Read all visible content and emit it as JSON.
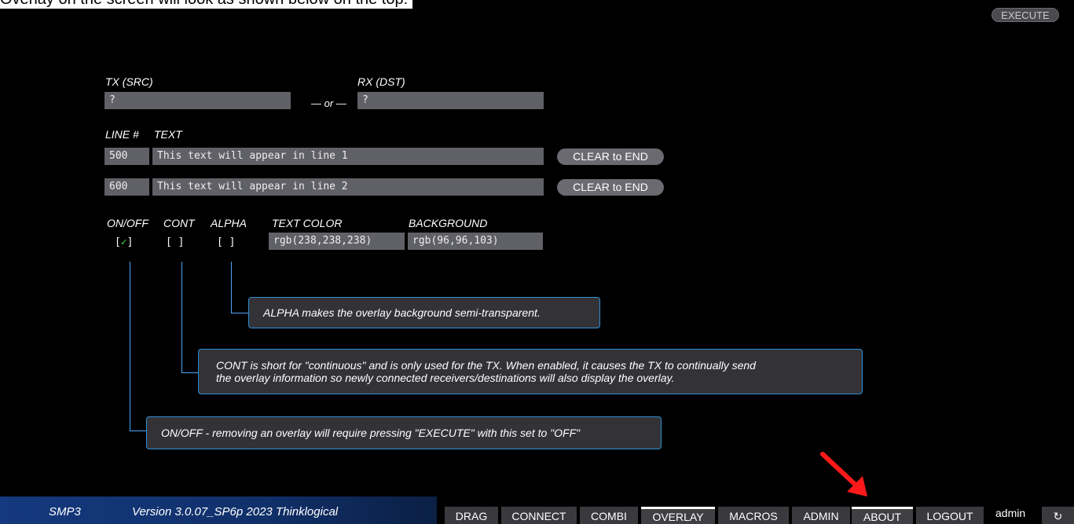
{
  "top_strip": {
    "text": "Overlay on the screen will look as shown below on the top:"
  },
  "execute_label": "EXECUTE",
  "source": {
    "tx_label": "TX (SRC)",
    "rx_label": "RX (DST)",
    "or_label": "— or —",
    "tx_value": "?",
    "rx_value": "?"
  },
  "lines_header": {
    "line_num_label": "LINE #",
    "text_label": "TEXT"
  },
  "lines": [
    {
      "number": "500",
      "text": "This text will appear in line 1",
      "clear_label": "CLEAR to END"
    },
    {
      "number": "600",
      "text": "This text will appear in line 2",
      "clear_label": "CLEAR to END"
    }
  ],
  "options": {
    "onoff_label": "ON/OFF",
    "cont_label": "CONT",
    "alpha_label": "ALPHA",
    "text_color_label": "TEXT COLOR",
    "background_label": "BACKGROUND",
    "onoff_checked": true,
    "cont_checked": false,
    "alpha_checked": false,
    "checkmark": "✓",
    "text_color_value": "rgb(238,238,238)",
    "background_value": "rgb(96,96,103)"
  },
  "callouts": {
    "alpha": "ALPHA makes the overlay background semi-transparent.",
    "cont_line1": "CONT is short for \"continuous\" and is only used for the TX. When enabled, it causes the TX to continually send",
    "cont_line2": "the overlay information so newly connected receivers/destinations will also display the overlay.",
    "onoff": "ON/OFF - removing an overlay will require pressing \"EXECUTE\" with this set to \"OFF\""
  },
  "footer": {
    "product": "SMP3",
    "version": "Version 3.0.07_SP6p  2023  Thinklogical",
    "tabs": [
      "DRAG",
      "CONNECT",
      "COMBI",
      "OVERLAY",
      "MACROS",
      "ADMIN",
      "ABOUT",
      "LOGOUT"
    ],
    "active_tabs": [
      "OVERLAY",
      "ABOUT"
    ],
    "user": "admin",
    "refresh_icon": "↻"
  },
  "colors": {
    "accent_blue": "#2f8fd6",
    "field_bg": "#606067",
    "brand_blue": "#15397e",
    "check_green": "#3fd83f",
    "arrow_red": "#ff1a1a"
  }
}
